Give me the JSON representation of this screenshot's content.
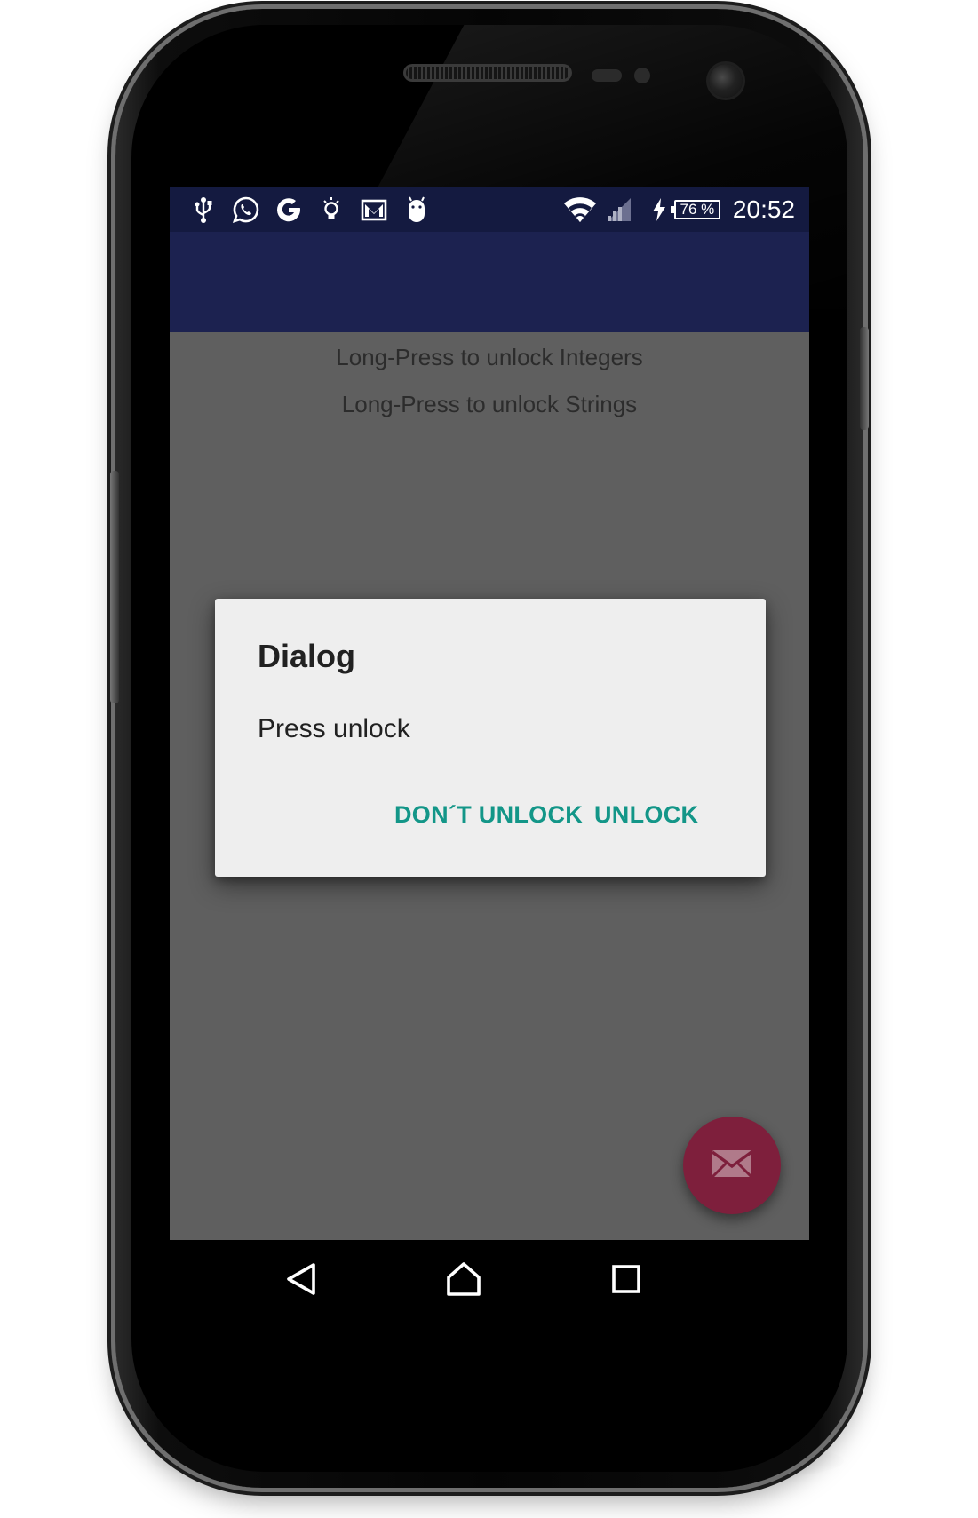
{
  "status_bar": {
    "left_icons": [
      "usb-icon",
      "whatsapp-icon",
      "google-icon",
      "lightbulb-icon",
      "gmail-icon",
      "android-icon"
    ],
    "right_icons": [
      "wifi-icon",
      "signal-icon",
      "charging-icon"
    ],
    "battery": "76 %",
    "time": "20:52"
  },
  "main": {
    "line1": "Long-Press to unlock Integers",
    "line2": "Long-Press to unlock Strings"
  },
  "dialog": {
    "title": "Dialog",
    "message": "Press unlock",
    "negative_button": "DON´T UNLOCK",
    "positive_button": "UNLOCK"
  },
  "fab": {
    "icon": "mail-icon"
  },
  "nav_bar": {
    "buttons": [
      "back-icon",
      "home-icon",
      "recents-icon"
    ]
  },
  "colors": {
    "status_bar": "#141a40",
    "toolbar": "#1c2250",
    "scrim_background": "#5f5f5f",
    "dialog_background": "#eeeeee",
    "accent": "#139688",
    "fab": "#7e1f3c"
  }
}
